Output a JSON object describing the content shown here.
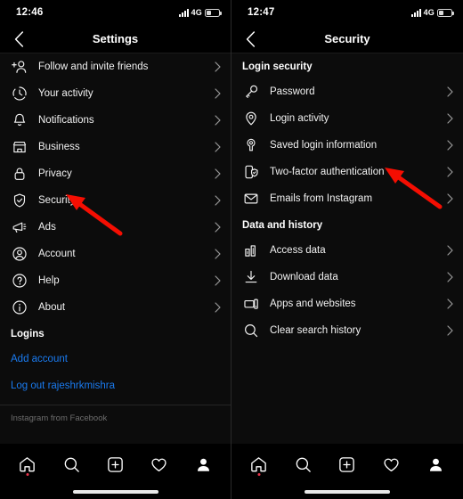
{
  "left_phone": {
    "status": {
      "time": "12:46",
      "network": "4G",
      "signal_icon": "signal-bars-icon",
      "battery_icon": "battery-icon"
    },
    "header": {
      "title": "Settings",
      "back_icon": "chevron-left-icon"
    },
    "menu_items": [
      {
        "label": "Follow and invite friends",
        "icon": "person-add-icon"
      },
      {
        "label": "Your activity",
        "icon": "clock-activity-icon"
      },
      {
        "label": "Notifications",
        "icon": "bell-icon"
      },
      {
        "label": "Business",
        "icon": "storefront-icon"
      },
      {
        "label": "Privacy",
        "icon": "lock-icon"
      },
      {
        "label": "Security",
        "icon": "shield-check-icon"
      },
      {
        "label": "Ads",
        "icon": "megaphone-icon"
      },
      {
        "label": "Account",
        "icon": "person-circle-icon"
      },
      {
        "label": "Help",
        "icon": "question-circle-icon"
      },
      {
        "label": "About",
        "icon": "info-circle-icon"
      }
    ],
    "logins_section": {
      "title": "Logins",
      "links": [
        {
          "label": "Add account"
        },
        {
          "label": "Log out rajeshrkmishra"
        }
      ]
    },
    "footnote": "Instagram from Facebook",
    "tabbar": [
      {
        "icon": "home-icon",
        "badge": true
      },
      {
        "icon": "search-icon",
        "badge": false
      },
      {
        "icon": "add-square-icon",
        "badge": false
      },
      {
        "icon": "heart-icon",
        "badge": false
      },
      {
        "icon": "profile-icon",
        "badge": false
      }
    ]
  },
  "right_phone": {
    "status": {
      "time": "12:47",
      "network": "4G",
      "signal_icon": "signal-bars-icon",
      "battery_icon": "battery-icon"
    },
    "header": {
      "title": "Security",
      "back_icon": "chevron-left-icon"
    },
    "login_security": {
      "title": "Login security",
      "items": [
        {
          "label": "Password",
          "icon": "key-icon"
        },
        {
          "label": "Login activity",
          "icon": "location-pin-icon"
        },
        {
          "label": "Saved login information",
          "icon": "keyhole-icon"
        },
        {
          "label": "Two-factor authentication",
          "icon": "phone-shield-icon"
        },
        {
          "label": "Emails from Instagram",
          "icon": "envelope-icon"
        }
      ]
    },
    "data_history": {
      "title": "Data and history",
      "items": [
        {
          "label": "Access data",
          "icon": "bar-chart-icon"
        },
        {
          "label": "Download data",
          "icon": "download-icon"
        },
        {
          "label": "Apps and websites",
          "icon": "apps-screens-icon"
        },
        {
          "label": "Clear search history",
          "icon": "search-icon"
        }
      ]
    },
    "tabbar": [
      {
        "icon": "home-icon",
        "badge": true
      },
      {
        "icon": "search-icon",
        "badge": false
      },
      {
        "icon": "add-square-icon",
        "badge": false
      },
      {
        "icon": "heart-icon",
        "badge": false
      },
      {
        "icon": "profile-icon",
        "badge": false
      }
    ]
  },
  "annotations": {
    "arrow_color": "#f50e02",
    "arrows": [
      {
        "name": "arrow-pointing-to-security",
        "target": "Security"
      },
      {
        "name": "arrow-pointing-to-two-factor-authentication",
        "target": "Two-factor authentication"
      }
    ]
  },
  "colors": {
    "background": "#0c0c0c",
    "bar_background": "#000000",
    "text": "#f2f2f2",
    "link": "#1a7bf0",
    "muted": "#6d6d6d",
    "badge": "#e8334a"
  }
}
